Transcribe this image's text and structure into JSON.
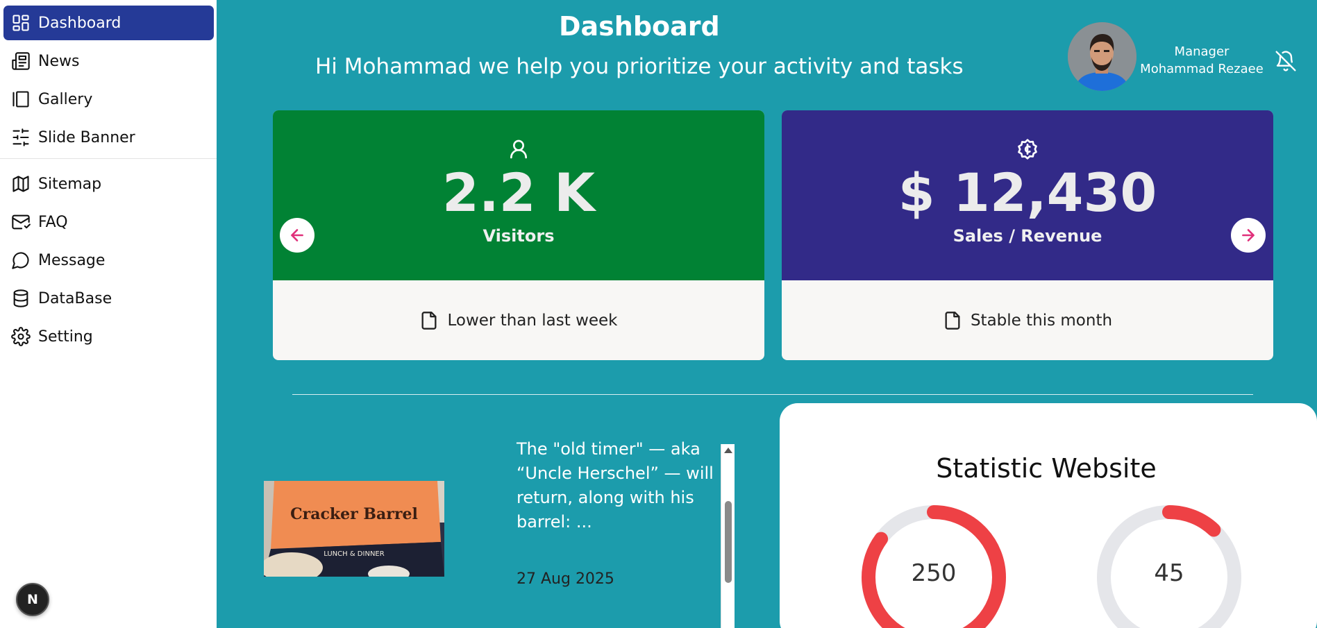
{
  "sidebar": {
    "items": [
      {
        "label": "Dashboard",
        "icon": "dashboard-icon",
        "active": true
      },
      {
        "label": "News",
        "icon": "newspaper-icon"
      },
      {
        "label": "Gallery",
        "icon": "gallery-icon"
      },
      {
        "label": "Slide Banner",
        "icon": "sliders-icon"
      },
      {
        "label": "Sitemap",
        "icon": "map-icon"
      },
      {
        "label": "FAQ",
        "icon": "mail-icon"
      },
      {
        "label": "Message",
        "icon": "message-icon"
      },
      {
        "label": "DataBase",
        "icon": "database-icon"
      },
      {
        "label": "Setting",
        "icon": "gear-icon"
      }
    ],
    "badge": "N"
  },
  "header": {
    "title": "Dashboard",
    "subtitle": "Hi Mohammad we help you prioritize your activity and tasks"
  },
  "user": {
    "role": "Manager",
    "name": "Mohammad Rezaee"
  },
  "cards": [
    {
      "value": "2.2 K",
      "label": "Visitors",
      "note": "Lower than last week",
      "icon": "user-icon",
      "color": "#018234"
    },
    {
      "value": "$ 12,430",
      "label": "Sales / Revenue",
      "note": "Stable this month",
      "icon": "coin-icon",
      "color": "#322a88"
    }
  ],
  "news": {
    "image_text": "Cracker Barrel",
    "image_subtext": "LUNCH & DINNER",
    "text": "The \"old timer\" — aka “Uncle Herschel” — will return, along with his barrel: ...",
    "date": "27 Aug 2025"
  },
  "statistics": {
    "title": "Statistic Website",
    "rings": [
      {
        "value": "250",
        "fraction": 0.85
      },
      {
        "value": "45",
        "fraction": 0.12
      }
    ]
  },
  "colors": {
    "background": "#1c9cac",
    "active_nav": "#253a97",
    "arrow": "#e0307a",
    "ring": "#ee4145",
    "ring_track": "#e5e6ea"
  }
}
